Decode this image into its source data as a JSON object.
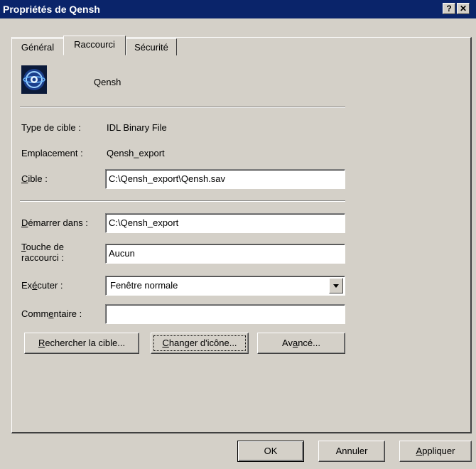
{
  "window": {
    "title": "Propriétés de Qensh",
    "help_label": "?",
    "close_label": "✕"
  },
  "tabs": [
    {
      "label": "Général"
    },
    {
      "label": "Raccourci"
    },
    {
      "label": "Sécurité"
    }
  ],
  "shortcut": {
    "name": "Qensh",
    "icon": "idl-program-icon",
    "target_type_label": "Type de cible :",
    "target_type_value": "IDL Binary File",
    "location_label": "Emplacement :",
    "location_value": "Qensh_export",
    "target_label_u": "C",
    "target_label_rest": "ible :",
    "target_value": "C:\\Qensh_export\\Qensh.sav",
    "start_in_label_u": "D",
    "start_in_label_rest": "émarrer dans :",
    "start_in_value": "C:\\Qensh_export",
    "hotkey_label_u": "T",
    "hotkey_label_rest": "ouche de",
    "hotkey_label_line2": "raccourci :",
    "hotkey_value": "Aucun",
    "run_label_pre": "Ex",
    "run_label_u": "é",
    "run_label_rest": "cuter :",
    "run_value": "Fenêtre normale",
    "comment_label_pre": "Comm",
    "comment_label_u": "e",
    "comment_label_rest": "ntaire :",
    "comment_value": ""
  },
  "buttons": {
    "find_target_u": "R",
    "find_target_rest": "echercher la cible...",
    "change_icon_u": "C",
    "change_icon_rest": "hanger d'icône...",
    "advanced_pre": "Av",
    "advanced_u": "a",
    "advanced_rest": "ncé...",
    "ok": "OK",
    "cancel": "Annuler",
    "apply_u": "A",
    "apply_rest": "ppliquer"
  }
}
